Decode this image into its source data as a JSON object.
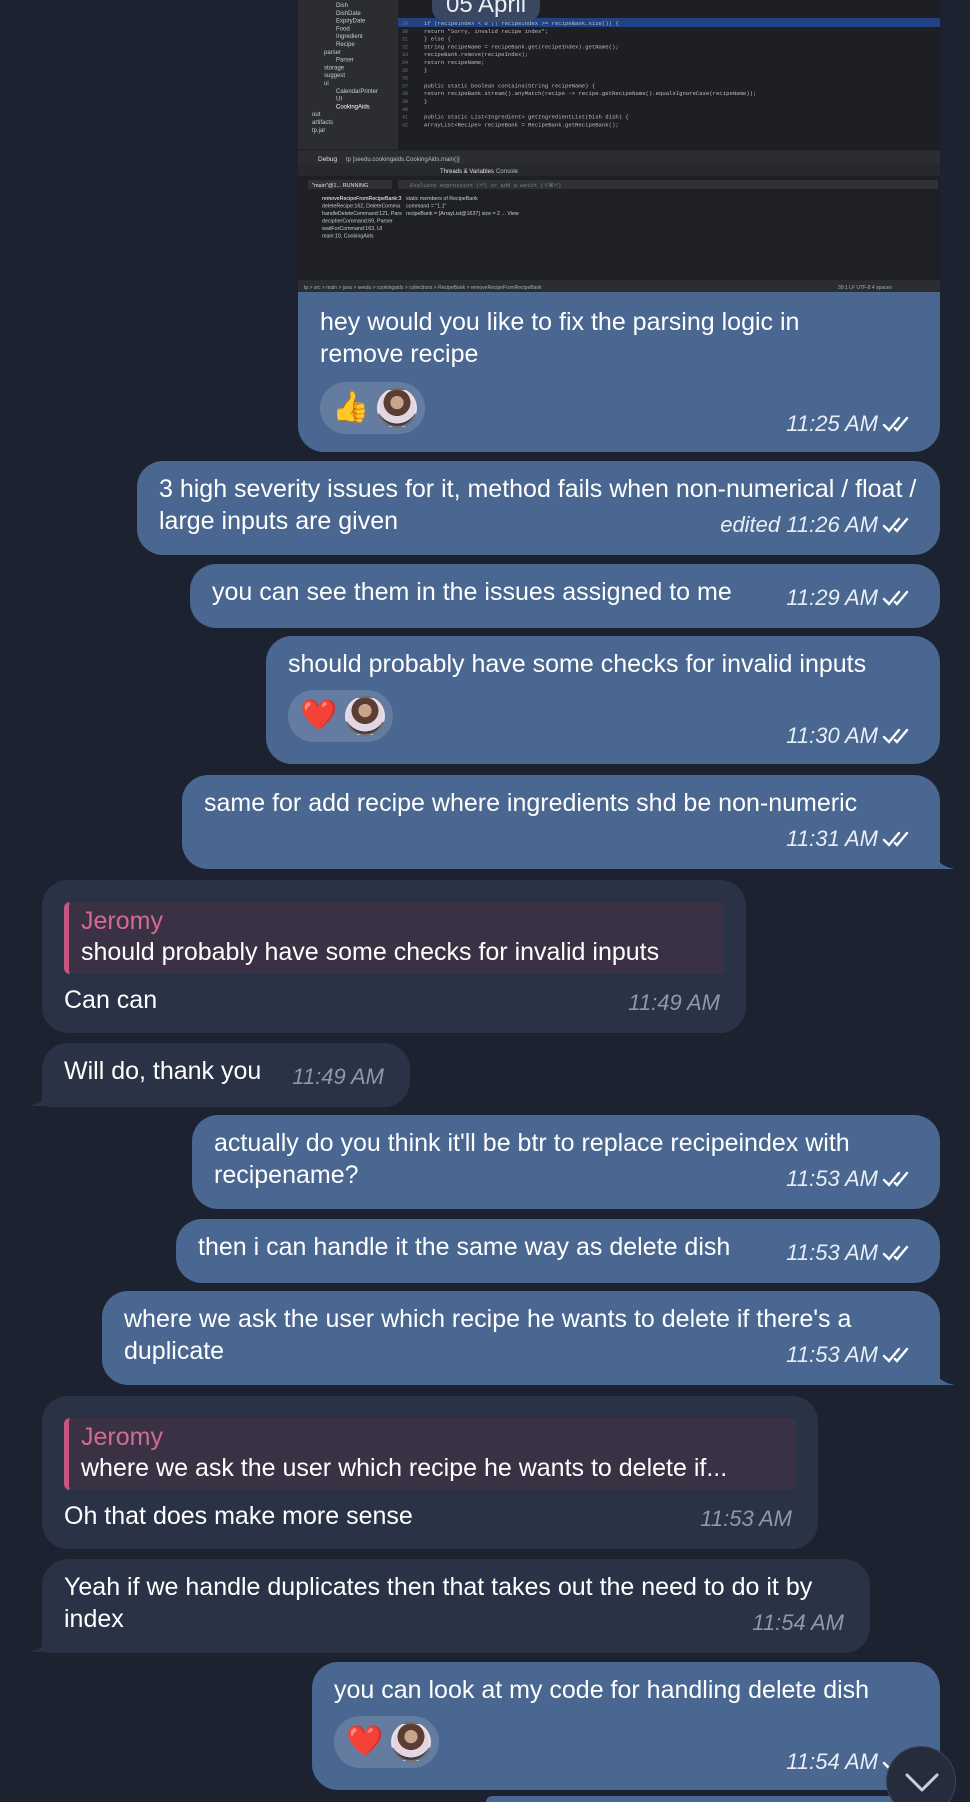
{
  "date_label": "05 April",
  "messages": [
    {
      "text": "hey would you like to fix the parsing logic in remove recipe",
      "time": "11:25 AM",
      "reactions": [
        "👍"
      ]
    },
    {
      "text": "3 high severity issues for it, method fails when non-numerical / float / large inputs are given",
      "edited": "edited",
      "time": "11:26 AM"
    },
    {
      "text": "you can see them in the issues assigned to me",
      "time": "11:29 AM"
    },
    {
      "text": "should probably have some checks for invalid inputs",
      "time": "11:30 AM",
      "reactions": [
        "❤️"
      ]
    },
    {
      "text": "same for add recipe where ingredients shd be non-numeric",
      "time": "11:31 AM"
    },
    {
      "reply_name": "Jeromy",
      "reply_text": "should probably have some checks for invalid inputs",
      "text": "Can can",
      "time": "11:49 AM"
    },
    {
      "text": "Will do, thank you",
      "time": "11:49 AM"
    },
    {
      "text": "actually do you think it'll be btr to replace recipeindex with recipename?",
      "time": "11:53 AM"
    },
    {
      "text": "then i can handle it the same way as delete dish",
      "time": "11:53 AM"
    },
    {
      "text": "where we ask the user which recipe he wants to delete if there's a duplicate",
      "time": "11:53 AM"
    },
    {
      "reply_name": "Jeromy",
      "reply_text": "where we ask the user which recipe he wants to delete if...",
      "text": "Oh that does make more sense",
      "time": "11:53 AM"
    },
    {
      "text": "Yeah if we handle duplicates then that takes out the need to do it by index",
      "time": "11:54 AM"
    },
    {
      "text": "you can look at my code for handling delete dish",
      "time": "11:54 AM",
      "reactions": [
        "❤️"
      ]
    }
  ],
  "screenshot": {
    "tree_items": [
      "Dish",
      "DishDate",
      "ExpiryDate",
      "Food",
      "Ingredient",
      "Recipe",
      "parser",
      "Parser",
      "storage",
      "suggest",
      "ui",
      "CalendarPrinter",
      "UI",
      "CookingAids",
      "out",
      "artifacts",
      "tp.jar"
    ],
    "debug_tab": "Debug",
    "debug_config": "tp [seedu.cookingaids.CookingAids.main()]",
    "threads_tab": "Threads & Variables",
    "console_tab": "Console",
    "thread_running": "\"main\"@1... RUNNING",
    "eval_placeholder": "Evaluate expression (⏎) or add a watch (⇧⌘⏎)",
    "frames": [
      "removeRecipeFromRecipeBank:3",
      "deleteRecipe:162, DeleteComma",
      "handleDeleteCommand:121, Pars",
      "decipherCommand:69, Parser",
      "waitForCommand:163, UI",
      "main:10, CookingAids"
    ],
    "variables": [
      "static  members of RecipeBank",
      "command = \"1.1\"",
      "recipeBank = {ArrayList@1637} size = 2 ... View"
    ],
    "status_left": "tp > src > main > java > seedu > cookingaids > collections > RecipeBank > removeRecipeFromRecipeBank",
    "status_right": "39:1   LF   UTF-8   4 spaces",
    "code_lines": [
      "if (recipeIndex < 0 || recipeIndex >= recipeBank.size()) {",
      "    return \"Sorry, invalid recipe index\";",
      "} else {",
      "    String recipeName = recipeBank.get(recipeIndex).getName();",
      "    recipeBank.remove(recipeIndex);",
      "    return recipeName;",
      "}",
      "",
      "public static boolean contains(String recipeName) {",
      "    return recipeBank.stream().anyMatch(recipe -> recipe.getRecipeName().equalsIgnoreCase(recipeName));",
      "}",
      "",
      "public static List<Ingredient> getIngredientList(Dish dish) {",
      "    ArrayList<Recipe> recipeBank = RecipeBank.getRecipeBank();"
    ]
  },
  "colors": {
    "background": "#1c2230",
    "outgoing_bubble": "#4a6791",
    "incoming_bubble": "#2a3346",
    "reply_accent": "#c5567f"
  }
}
